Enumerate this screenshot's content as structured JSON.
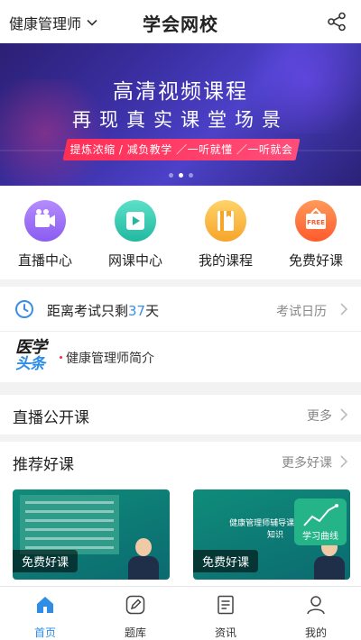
{
  "header": {
    "category": "健康管理师",
    "title": "学会网校"
  },
  "banner": {
    "title": "高清视频课程",
    "subtitle": "再现真实课堂场景",
    "tagline": "提炼浓缩 / 减负教学 ／一听就懂 ／一听就会"
  },
  "quick_nav": [
    {
      "label": "直播中心",
      "icon": "live-camera-icon",
      "color": "#9b6cf6"
    },
    {
      "label": "网课中心",
      "icon": "play-icon",
      "color": "#2cc3a8"
    },
    {
      "label": "我的课程",
      "icon": "book-icon",
      "color": "#f7b23a"
    },
    {
      "label": "免费好课",
      "icon": "free-tag-icon",
      "color": "#ff6a3a"
    }
  ],
  "exam": {
    "prefix": "距离考试只剩",
    "days": "37",
    "suffix": "天",
    "calendar_label": "考试日历"
  },
  "news": {
    "logo_line1": "医学",
    "logo_line2": "头条",
    "text": "健康管理师简介"
  },
  "live_section": {
    "title": "直播公开课",
    "more": "更多"
  },
  "recommend_section": {
    "title": "推荐好课",
    "more": "更多好课"
  },
  "cards": [
    {
      "tag": "免费好课"
    },
    {
      "tag": "免费好课",
      "title": "健康管理师辅导课程 基础知识",
      "badge": "学习曲线"
    }
  ],
  "tabs": [
    {
      "label": "首页",
      "icon": "home-icon",
      "active": true
    },
    {
      "label": "题库",
      "icon": "pencil-icon",
      "active": false
    },
    {
      "label": "资讯",
      "icon": "news-icon",
      "active": false
    },
    {
      "label": "我的",
      "icon": "user-icon",
      "active": false
    }
  ],
  "colors": {
    "accent": "#2e8de6",
    "exam_number": "#3a8ee6",
    "banner_pill": "#ff2e55"
  }
}
